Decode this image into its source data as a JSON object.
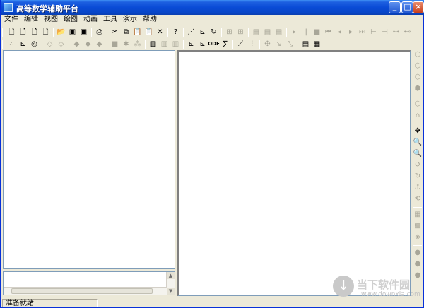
{
  "window": {
    "title": "高等数学辅助平台",
    "minimize_glyph": "_",
    "maximize_glyph": "□",
    "close_glyph": "×"
  },
  "menu": [
    {
      "label": "文件"
    },
    {
      "label": "编辑"
    },
    {
      "label": "视图"
    },
    {
      "label": "绘图"
    },
    {
      "label": "动画"
    },
    {
      "label": "工具"
    },
    {
      "label": "演示"
    },
    {
      "label": "帮助"
    }
  ],
  "toolbar1": [
    {
      "icon": "new-file-icon",
      "glyph": "🗋",
      "enabled": true
    },
    {
      "icon": "new-file-2-icon",
      "glyph": "🗋",
      "enabled": true
    },
    {
      "icon": "new-file-3-icon",
      "glyph": "🗋",
      "enabled": true
    },
    {
      "icon": "new-file-4-icon",
      "glyph": "🗋",
      "enabled": true
    },
    {
      "sep": true
    },
    {
      "icon": "open-folder-icon",
      "glyph": "📂",
      "enabled": true
    },
    {
      "icon": "save-icon",
      "glyph": "▣",
      "enabled": true
    },
    {
      "icon": "save-as-icon",
      "glyph": "▣",
      "enabled": true
    },
    {
      "sep": true
    },
    {
      "icon": "print-icon",
      "glyph": "⎙",
      "enabled": true
    },
    {
      "sep": true
    },
    {
      "icon": "cut-icon",
      "glyph": "✂",
      "enabled": true
    },
    {
      "icon": "copy-icon",
      "glyph": "⧉",
      "enabled": true
    },
    {
      "icon": "paste-icon",
      "glyph": "📋",
      "enabled": true
    },
    {
      "icon": "paste-special-icon",
      "glyph": "📋",
      "enabled": true
    },
    {
      "icon": "delete-icon",
      "glyph": "✕",
      "enabled": true
    },
    {
      "sep": true
    },
    {
      "icon": "help-icon",
      "glyph": "?",
      "enabled": true
    },
    {
      "sep": true
    },
    {
      "icon": "point-plot-icon",
      "glyph": "⋰",
      "enabled": true
    },
    {
      "icon": "curve-plot-icon",
      "glyph": "⊾",
      "enabled": true
    },
    {
      "icon": "curve-edit-icon",
      "glyph": "↻",
      "enabled": true
    },
    {
      "sep": true
    },
    {
      "icon": "graph-disabled-1-icon",
      "glyph": "⊞",
      "enabled": false
    },
    {
      "icon": "graph-disabled-2-icon",
      "glyph": "⊞",
      "enabled": false
    },
    {
      "sep": true
    },
    {
      "icon": "3d-disabled-1-icon",
      "glyph": "▤",
      "enabled": false
    },
    {
      "icon": "3d-disabled-2-icon",
      "glyph": "▤",
      "enabled": false
    },
    {
      "icon": "3d-disabled-3-icon",
      "glyph": "▤",
      "enabled": false
    },
    {
      "sep": true
    },
    {
      "icon": "play-icon",
      "glyph": "▸",
      "enabled": false
    },
    {
      "icon": "pause-icon",
      "glyph": "‖",
      "enabled": false
    },
    {
      "icon": "stop-icon",
      "glyph": "■",
      "enabled": false
    },
    {
      "icon": "first-frame-icon",
      "glyph": "⏮",
      "enabled": false
    },
    {
      "icon": "prev-frame-icon",
      "glyph": "◂",
      "enabled": false
    },
    {
      "icon": "next-frame-icon",
      "glyph": "▸",
      "enabled": false
    },
    {
      "icon": "last-frame-icon",
      "glyph": "⏭",
      "enabled": false
    },
    {
      "icon": "range-1-icon",
      "glyph": "⊢",
      "enabled": false
    },
    {
      "icon": "range-2-icon",
      "glyph": "⊣",
      "enabled": false
    },
    {
      "icon": "range-3-icon",
      "glyph": "⊶",
      "enabled": false
    },
    {
      "icon": "range-4-icon",
      "glyph": "⊷",
      "enabled": false
    }
  ],
  "toolbar2": [
    {
      "icon": "scatter-icon",
      "glyph": "∴",
      "enabled": true
    },
    {
      "icon": "function-plot-icon",
      "glyph": "⊾",
      "enabled": true
    },
    {
      "icon": "polar-plot-icon",
      "glyph": "◎",
      "enabled": true
    },
    {
      "sep": true
    },
    {
      "icon": "surface-disabled-1-icon",
      "glyph": "◇",
      "enabled": false
    },
    {
      "icon": "surface-disabled-2-icon",
      "glyph": "◇",
      "enabled": false
    },
    {
      "sep": true
    },
    {
      "icon": "solid-disabled-1-icon",
      "glyph": "◆",
      "enabled": false
    },
    {
      "icon": "solid-disabled-2-icon",
      "glyph": "◆",
      "enabled": false
    },
    {
      "icon": "solid-disabled-3-icon",
      "glyph": "◆",
      "enabled": false
    },
    {
      "sep": true
    },
    {
      "icon": "shape-disabled-1-icon",
      "glyph": "■",
      "enabled": false
    },
    {
      "icon": "shape-disabled-2-icon",
      "glyph": "✱",
      "enabled": false
    },
    {
      "icon": "shape-disabled-3-icon",
      "glyph": "⁂",
      "enabled": false
    },
    {
      "sep": true
    },
    {
      "icon": "table-icon",
      "glyph": "▥",
      "enabled": true
    },
    {
      "icon": "table-disabled-1-icon",
      "glyph": "▥",
      "enabled": false
    },
    {
      "icon": "table-disabled-2-icon",
      "glyph": "▥",
      "enabled": false
    },
    {
      "sep": true
    },
    {
      "icon": "axes-icon",
      "glyph": "⊾",
      "enabled": true
    },
    {
      "icon": "axes-grid-icon",
      "glyph": "⊾",
      "enabled": true
    },
    {
      "icon": "ode-icon",
      "glyph": "ODE",
      "enabled": true
    },
    {
      "icon": "equation-icon",
      "glyph": "∑",
      "enabled": true
    },
    {
      "sep": true
    },
    {
      "icon": "tangent-icon",
      "glyph": "⟋",
      "enabled": true
    },
    {
      "icon": "bar-chart-icon",
      "glyph": "⫶",
      "enabled": true
    },
    {
      "sep": true
    },
    {
      "icon": "transform-disabled-1-icon",
      "glyph": "✣",
      "enabled": false
    },
    {
      "icon": "transform-disabled-2-icon",
      "glyph": "↘",
      "enabled": false
    },
    {
      "icon": "transform-disabled-3-icon",
      "glyph": "⤡",
      "enabled": false
    },
    {
      "sep": true
    },
    {
      "icon": "document-icon",
      "glyph": "▤",
      "enabled": true
    },
    {
      "icon": "calculator-icon",
      "glyph": "▦",
      "enabled": true
    }
  ],
  "side_toolbar": [
    {
      "icon": "cube-view-1-icon",
      "glyph": "⬡",
      "enabled": false
    },
    {
      "icon": "cube-view-2-icon",
      "glyph": "⬡",
      "enabled": false
    },
    {
      "icon": "cube-view-3-icon",
      "glyph": "⬡",
      "enabled": false
    },
    {
      "icon": "cube-view-4-icon",
      "glyph": "⬢",
      "enabled": false
    },
    {
      "sep": true
    },
    {
      "icon": "cube-view-5-icon",
      "glyph": "⬡",
      "enabled": false
    },
    {
      "icon": "house-icon",
      "glyph": "⌂",
      "enabled": false
    },
    {
      "sep": true
    },
    {
      "icon": "move-icon",
      "glyph": "✥",
      "enabled": true
    },
    {
      "icon": "zoom-in-icon",
      "glyph": "🔍",
      "enabled": true
    },
    {
      "icon": "zoom-out-icon",
      "glyph": "🔍",
      "enabled": true
    },
    {
      "icon": "rotate-left-icon",
      "glyph": "↺",
      "enabled": false
    },
    {
      "icon": "rotate-right-icon",
      "glyph": "↻",
      "enabled": false
    },
    {
      "icon": "anchor-icon",
      "glyph": "⚓",
      "enabled": false
    },
    {
      "icon": "spin-icon",
      "glyph": "⟲",
      "enabled": false
    },
    {
      "sep": true
    },
    {
      "icon": "mesh-1-icon",
      "glyph": "▦",
      "enabled": false
    },
    {
      "icon": "mesh-2-icon",
      "glyph": "▩",
      "enabled": false
    },
    {
      "icon": "layer-icon",
      "glyph": "◈",
      "enabled": false
    },
    {
      "sep": true
    },
    {
      "icon": "sphere-1-icon",
      "glyph": "●",
      "enabled": false
    },
    {
      "icon": "sphere-2-icon",
      "glyph": "●",
      "enabled": false
    },
    {
      "icon": "sphere-3-icon",
      "glyph": "●",
      "enabled": false
    }
  ],
  "status": {
    "text": "准备就绪"
  },
  "watermark": {
    "brand": "当下软件园",
    "url": "www.downxia.com",
    "icon_glyph": "↓"
  },
  "colors": {
    "title_bar": "#0a4bd6",
    "face": "#ece9d8",
    "pane": "#ffffff",
    "disabled_icon": "#a8a698"
  }
}
